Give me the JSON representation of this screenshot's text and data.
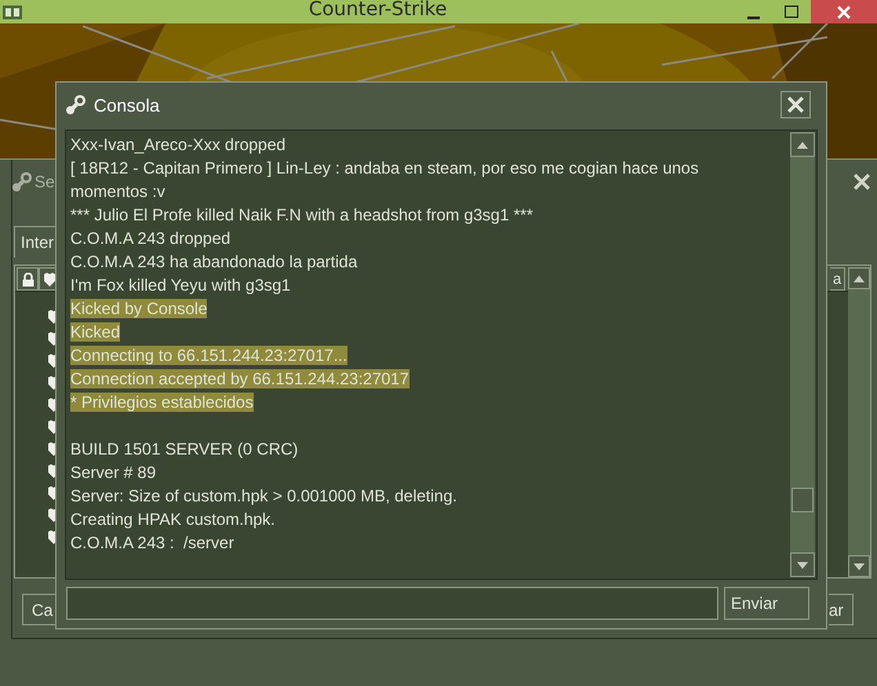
{
  "app_title": "Counter-Strike",
  "background_window": {
    "title": "Se",
    "tab": "Inter",
    "column_3": "a",
    "buttons": [
      "Ca",
      "ar"
    ]
  },
  "console": {
    "title": "Consola",
    "send_button": "Enviar",
    "lines": [
      {
        "text": "Xxx-Ivan_Areco-Xxx dropped",
        "highlighted": false
      },
      {
        "text": "[ 18R12 - Capitan Primero ] Lin-Ley : andaba en steam, por eso me cogian hace unos momentos :v",
        "highlighted": false
      },
      {
        "text": "*** Julio El Profe killed Naik F.N with a headshot from g3sg1 ***",
        "highlighted": false
      },
      {
        "text": "C.O.M.A 243 dropped",
        "highlighted": false
      },
      {
        "text": "C.O.M.A 243 ha abandonado la partida",
        "highlighted": false
      },
      {
        "text": "I'm Fox killed Yeyu with g3sg1",
        "highlighted": false
      },
      {
        "text": "Kicked by Console",
        "highlighted": true
      },
      {
        "text": "Kicked",
        "highlighted": true
      },
      {
        "text": "Connecting to 66.151.244.23:27017...",
        "highlighted": true
      },
      {
        "text": "Connection accepted by 66.151.244.23:27017",
        "highlighted": true
      },
      {
        "text": "* Privilegios establecidos",
        "highlighted": true
      },
      {
        "text": "BUILD 1501 SERVER (0 CRC)",
        "highlighted": false,
        "blank_before": true
      },
      {
        "text": "Server # 89",
        "highlighted": false
      },
      {
        "text": "Server: Size of custom.hpk > 0.001000 MB, deleting.",
        "highlighted": false
      },
      {
        "text": "Creating HPAK custom.hpk.",
        "highlighted": false
      },
      {
        "text": "C.O.M.A 243 :  /server",
        "highlighted": false
      }
    ]
  }
}
